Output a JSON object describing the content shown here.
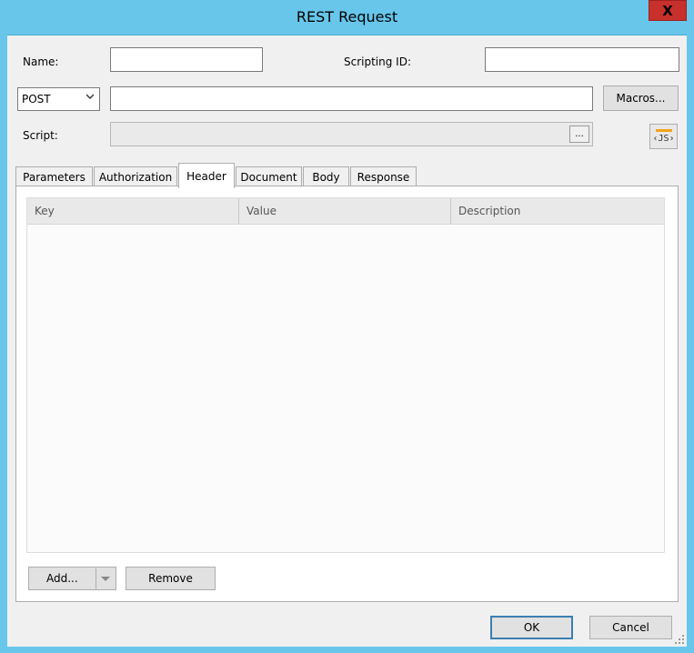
{
  "window": {
    "title": "REST Request",
    "close_glyph": "X"
  },
  "form": {
    "name_label": "Name:",
    "name_value": "",
    "scripting_id_label": "Scripting ID:",
    "scripting_id_value": "",
    "method_value": "POST",
    "url_value": "",
    "macros_label": "Macros...",
    "script_label": "Script:",
    "script_value": "",
    "script_browse_label": "...",
    "js_button_label": "‹JS›"
  },
  "tabs": [
    {
      "label": "Parameters",
      "active": false
    },
    {
      "label": "Authorization",
      "active": false
    },
    {
      "label": "Header",
      "active": true
    },
    {
      "label": "Document",
      "active": false
    },
    {
      "label": "Body",
      "active": false
    },
    {
      "label": "Response",
      "active": false
    }
  ],
  "header_grid": {
    "columns": [
      "Key",
      "Value",
      "Description"
    ],
    "rows": []
  },
  "grid_buttons": {
    "add_label": "Add...",
    "remove_label": "Remove"
  },
  "footer": {
    "ok_label": "OK",
    "cancel_label": "Cancel"
  },
  "colors": {
    "titlebar": "#67c6ea",
    "close": "#c8302c",
    "js_accent": "#f4a21a"
  }
}
